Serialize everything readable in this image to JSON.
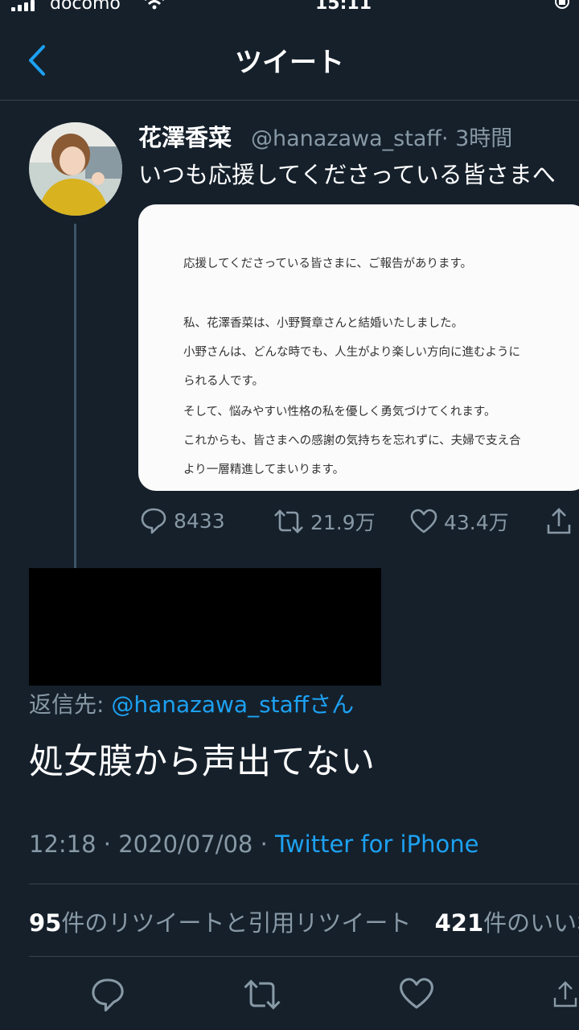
{
  "status_bar": {
    "carrier": "docomo",
    "time": "15:11"
  },
  "header": {
    "title": "ツイート"
  },
  "quoted_tweet": {
    "author_name": "花澤香菜",
    "handle": "@hanazawa_staff",
    "time_ago": "· 3時間",
    "text": "いつも応援してくださっている皆さまへ",
    "image_lines": [
      "応援してくださっている皆さまに、ご報告があります。",
      "私、花澤香菜は、小野賢章さんと結婚いたしました。",
      "小野さんは、どんな時でも、人生がより楽しい方向に進むように",
      "られる人です。",
      "そして、悩みやすい性格の私を優しく勇気づけてくれます。",
      "これからも、皆さまへの感謝の気持ちを忘れずに、夫婦で支え合",
      "より一層精進してまいります。"
    ],
    "replies": "8433",
    "retweets": "21.9万",
    "likes": "43.4万"
  },
  "reply": {
    "reply_to_label": "返信先: ",
    "reply_to_handle": "@hanazawa_staff",
    "reply_to_suffix": "さん",
    "text": "処女膜から声出てない",
    "time": "12:18 · 2020/07/08 · ",
    "source": "Twitter for iPhone",
    "retweet_count": "95",
    "retweet_label": "件のリツイートと引用リツイート",
    "like_count": "421",
    "like_label": "件のいいね"
  },
  "colors": {
    "background": "#15202b",
    "accent": "#1da1f2",
    "secondary": "#8899a6"
  }
}
